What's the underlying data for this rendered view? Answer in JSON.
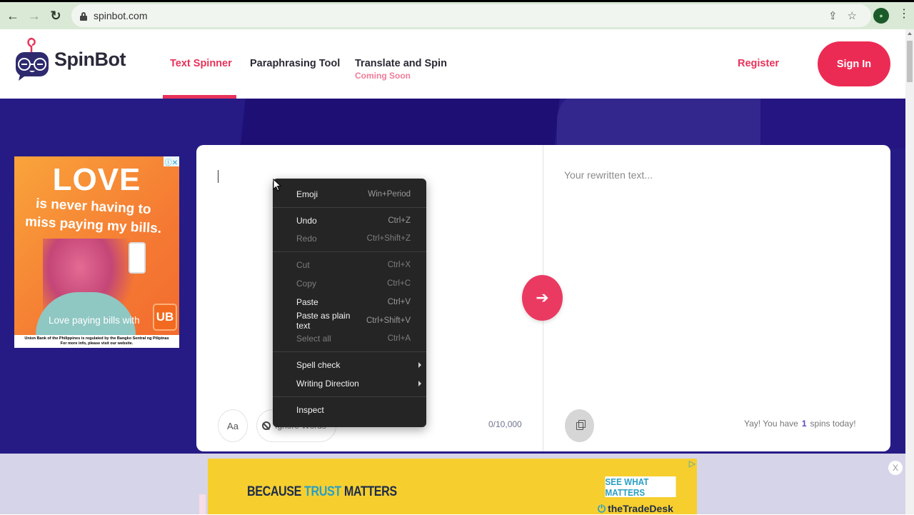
{
  "browser": {
    "url": "spinbot.com",
    "icons": {
      "back": "back-arrow-icon",
      "forward": "forward-arrow-icon",
      "reload": "reload-icon",
      "lock": "lock-icon",
      "share": "share-icon",
      "bookmark": "star-icon",
      "profile": "profile-avatar",
      "menu": "kebab-menu-icon"
    },
    "glyphs": {
      "back": "←",
      "forward": "→",
      "reload": "↻",
      "share": "⇪",
      "bookmark": "☆",
      "profile": "●",
      "menu": "⋮"
    }
  },
  "header": {
    "brand": "SpinBot",
    "nav": [
      {
        "label": "Text Spinner",
        "active": true
      },
      {
        "label": "Paraphrasing Tool",
        "active": false
      },
      {
        "label": "Translate and Spin",
        "sublabel": "Coming Soon",
        "active": false
      }
    ],
    "register_label": "Register",
    "signin_label": "Sign In",
    "colors": {
      "accent": "#ec2b54",
      "hero_bg": "#261b85"
    }
  },
  "editor": {
    "input_value": "",
    "output_placeholder": "Your rewritten text...",
    "spin_glyph": "➔",
    "case_button_label": "Aa",
    "ignore_words_label": "Ignore Words",
    "char_counter": "0/10,000",
    "spins_prefix": "Yay! You have",
    "spins_count": "1",
    "spins_suffix": "spins today!"
  },
  "context_menu": {
    "groups": [
      [
        {
          "label": "Emoji",
          "shortcut": "Win+Period",
          "disabled": false
        }
      ],
      [
        {
          "label": "Undo",
          "shortcut": "Ctrl+Z",
          "disabled": false
        },
        {
          "label": "Redo",
          "shortcut": "Ctrl+Shift+Z",
          "disabled": true
        }
      ],
      [
        {
          "label": "Cut",
          "shortcut": "Ctrl+X",
          "disabled": true
        },
        {
          "label": "Copy",
          "shortcut": "Ctrl+C",
          "disabled": true
        },
        {
          "label": "Paste",
          "shortcut": "Ctrl+V",
          "disabled": false
        },
        {
          "label": "Paste as plain text",
          "shortcut": "Ctrl+Shift+V",
          "disabled": false
        },
        {
          "label": "Select all",
          "shortcut": "Ctrl+A",
          "disabled": true
        }
      ],
      [
        {
          "label": "Spell check",
          "submenu": true,
          "disabled": false
        },
        {
          "label": "Writing Direction",
          "submenu": true,
          "disabled": false
        }
      ],
      [
        {
          "label": "Inspect",
          "disabled": false
        }
      ]
    ]
  },
  "ads": {
    "left": {
      "headline": "LOVE",
      "line2": "is never having to",
      "line3": "miss paying my bills.",
      "tagline": "Love paying bills with",
      "logo": "UB",
      "disclaimer_1": "Union Bank of the Philippines is regulated by the Bangko Sentral ng Pilipinas",
      "disclaimer_2": "For more info, please visit our website.",
      "adchoice": "ⓘ✕"
    },
    "bottom": {
      "headline_1": "BECAUSE ",
      "headline_2": "TRUST",
      "headline_3": " MATTERS",
      "cta": "SEE WHAT MATTERS",
      "brand_icon": "⏻",
      "brand": "theTradeDesk",
      "adchoice": "▷",
      "close": "X"
    }
  }
}
